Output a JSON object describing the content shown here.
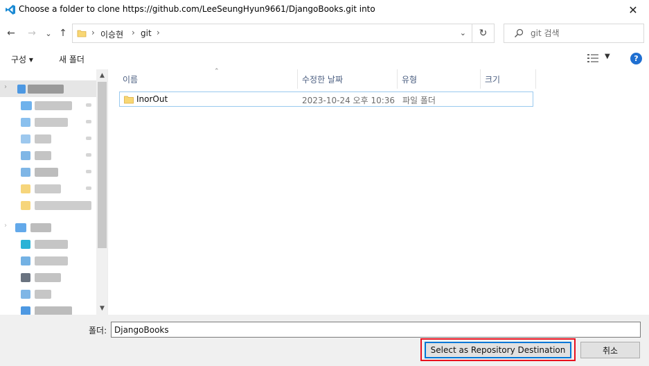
{
  "window": {
    "title": "Choose a folder to clone https://github.com/LeeSeungHyun9661/DjangoBooks.git into",
    "close_glyph": "✕",
    "accent_color": "#0078d7"
  },
  "navigation": {
    "back_glyph": "←",
    "forward_glyph": "→",
    "recent_glyph": "⌄",
    "up_glyph": "↑",
    "breadcrumb": [
      "이승현",
      "git"
    ],
    "refresh_glyph": "↻",
    "search_placeholder": "git 검색"
  },
  "toolbar": {
    "organize_label": "구성 ▾",
    "new_folder_label": "새 폴더",
    "help_label": "?"
  },
  "columns": [
    {
      "label": "이름"
    },
    {
      "label": "수정한 날짜"
    },
    {
      "label": "유형"
    },
    {
      "label": "크기"
    }
  ],
  "files": [
    {
      "name": "InorOut",
      "modified": "2023-10-24 오후 10:36",
      "type": "파일 폴더",
      "size": ""
    }
  ],
  "footer": {
    "folder_label": "폴더:",
    "folder_value": "DjangoBooks",
    "select_button": "Select as Repository Destination",
    "cancel_button": "취소",
    "highlight_color": "#e8101e"
  }
}
